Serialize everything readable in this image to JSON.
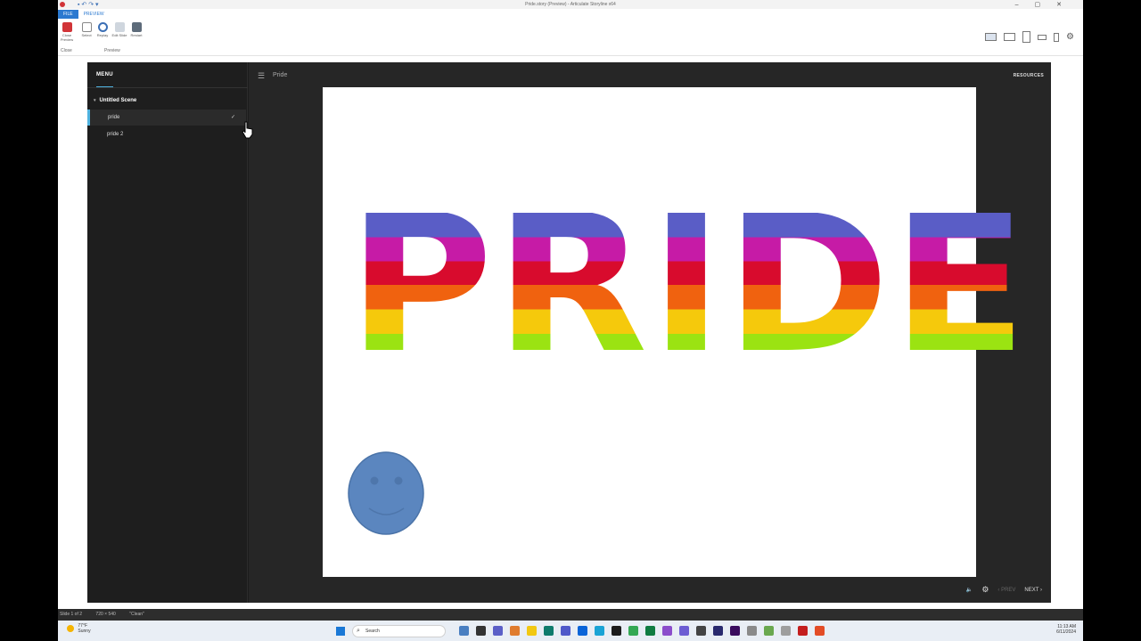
{
  "titlebar": {
    "title": "Pride.story (Preview) - Articulate Storyline x64"
  },
  "ribbon": {
    "tabs": [
      "FILE",
      "PREVIEW"
    ],
    "buttons": [
      {
        "label": "Close Preview",
        "group": "Close"
      },
      {
        "label": "Select"
      },
      {
        "label": "Replay"
      },
      {
        "label": "Edit Slide"
      },
      {
        "label": "Restart"
      }
    ],
    "groups": [
      "Close",
      "Preview"
    ]
  },
  "player": {
    "menu_title": "MENU",
    "scene": "Untitled Scene",
    "slides": [
      {
        "label": "pride",
        "active": true
      },
      {
        "label": "pride 2",
        "active": false
      }
    ],
    "slide_title": "Pride",
    "resources": "RESOURCES",
    "slide_text": "PRIDE",
    "prev": "PREV",
    "next": "NEXT"
  },
  "statusbar": {
    "slide": "Slide 1 of 2",
    "size": "720 × 540",
    "theme": "\"Clean\""
  },
  "taskbar": {
    "weather_temp": "77°F",
    "weather_desc": "Sunny",
    "search": "Search",
    "time": "11:13 AM",
    "date": "6/11/2024"
  },
  "colors": {
    "accent": "#4fb3e0",
    "rainbow": [
      "#5a5dc6",
      "#c61ba6",
      "#d80b2d",
      "#f0620f",
      "#f5c90c",
      "#9be312"
    ],
    "smiley": "#5b86bf"
  }
}
